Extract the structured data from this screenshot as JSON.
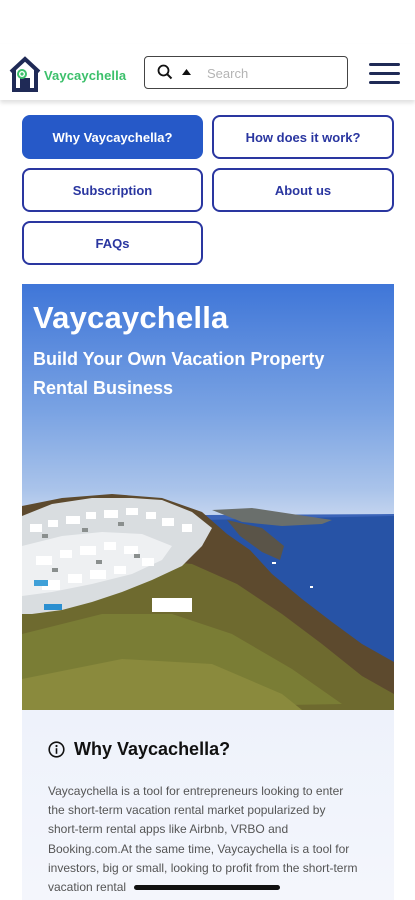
{
  "header": {
    "logo_text": "Vaycaychella",
    "search_placeholder": "Search",
    "icons": {
      "search": "magnifier-icon",
      "caret": "caret-up-icon",
      "menu": "hamburger-menu-icon",
      "logo": "house-logo-icon"
    }
  },
  "nav": {
    "why": "Why Vaycaychella?",
    "how": "How does it work?",
    "subscription": "Subscription",
    "about": "About us",
    "faqs": "FAQs"
  },
  "hero": {
    "title": "Vaycaychella",
    "subtitle": "Build Your Own Vacation Property Rental Business"
  },
  "info": {
    "title": "Why Vaycachella?",
    "body": "Vaycaychella is a tool for entrepreneurs looking to enter the short-term vacation rental market popularized by short-term rental apps like Airbnb, VRBO and Booking.com.At the same time, Vaycaychella is a tool for investors, big or small, looking to profit from the short-term vacation rental"
  },
  "colors": {
    "brand_green": "#3cc06b",
    "brand_navy": "#1f2a56",
    "button_border": "#2a36a0",
    "button_active": "#2659c8"
  }
}
